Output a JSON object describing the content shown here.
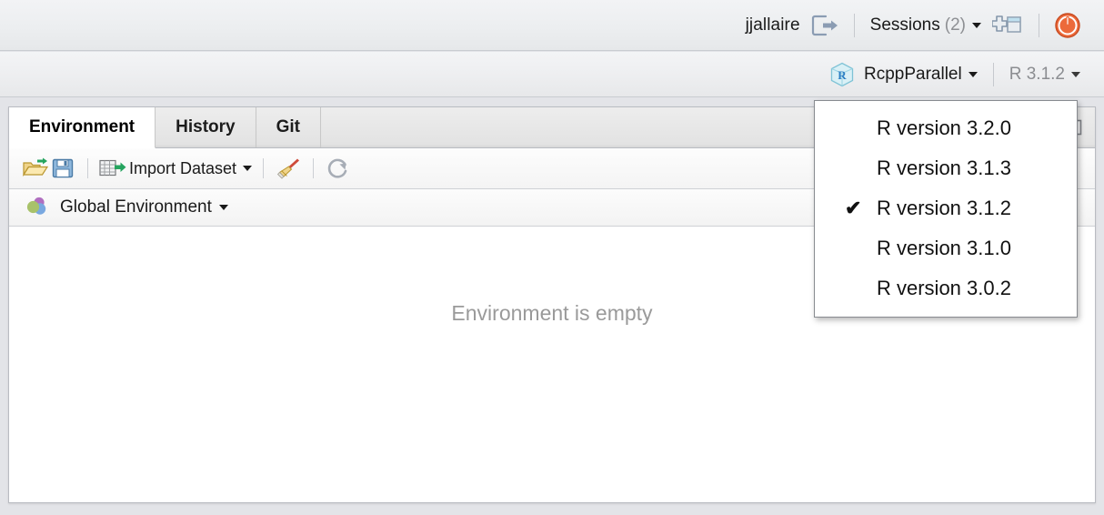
{
  "global_bar": {
    "user_name": "jjallaire",
    "signout_icon": "signout-icon",
    "sessions_label": "Sessions",
    "sessions_count": "(2)",
    "new_session_icon": "new-session-icon",
    "power_icon": "power-icon"
  },
  "project_bar": {
    "project_icon": "r-project-cube-icon",
    "project_name": "RcppParallel",
    "r_version_label": "R 3.1.2"
  },
  "panel": {
    "tabs": [
      {
        "label": "Environment",
        "active": true
      },
      {
        "label": "History",
        "active": false
      },
      {
        "label": "Git",
        "active": false
      }
    ],
    "minmax_icon": "panel-maximize-icon",
    "toolbar": {
      "load_icon": "open-folder-icon",
      "save_icon": "save-floppy-icon",
      "import_icon": "import-grid-icon",
      "import_label": "Import Dataset",
      "clear_icon": "broom-clear-icon",
      "refresh_icon": "refresh-icon"
    },
    "environment_selector": {
      "icon": "global-environment-icon",
      "label": "Global Environment"
    },
    "empty_message": "Environment is empty"
  },
  "r_version_menu": {
    "items": [
      {
        "label": "R version 3.2.0",
        "checked": false
      },
      {
        "label": "R version 3.1.3",
        "checked": false
      },
      {
        "label": "R version 3.1.2",
        "checked": true
      },
      {
        "label": "R version 3.1.0",
        "checked": false
      },
      {
        "label": "R version 3.0.2",
        "checked": false
      }
    ],
    "check_glyph": "✔"
  },
  "colors": {
    "power_orange": "#e8582c",
    "signout_blue_gray": "#8b9cb3",
    "empty_text_gray": "#9a9a9a",
    "project_icon_cyan": "#bfe6ef",
    "env_green": "#a8c26a",
    "env_purple": "#b06fc0",
    "env_blue": "#79a8e0"
  }
}
